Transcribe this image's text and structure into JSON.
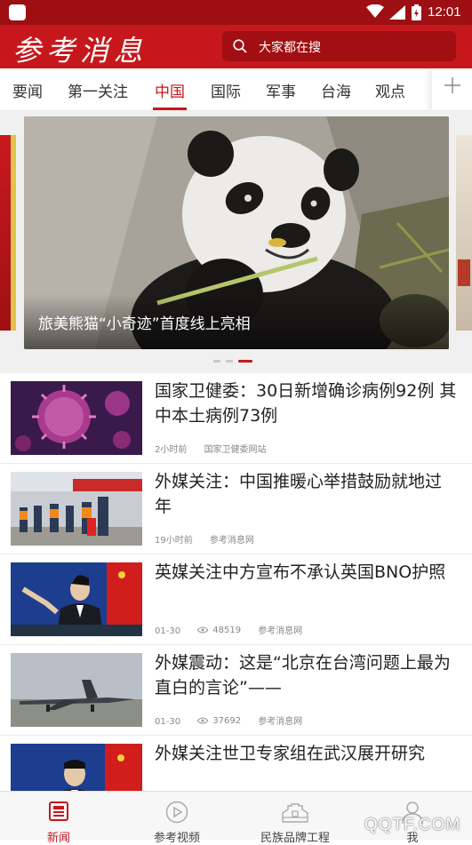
{
  "status_bar": {
    "time": "12:01"
  },
  "header": {
    "logo_text": "参考消息",
    "search_placeholder": "大家都在搜"
  },
  "tabs": [
    {
      "label": "要闻"
    },
    {
      "label": "第一关注"
    },
    {
      "label": "中国",
      "active": true
    },
    {
      "label": "国际"
    },
    {
      "label": "军事"
    },
    {
      "label": "台海"
    },
    {
      "label": "观点"
    }
  ],
  "carousel": {
    "caption": "旅美熊猫“小奇迹”首度线上亮相",
    "dots": 3,
    "active_dot": 2
  },
  "news": [
    {
      "title": "国家卫健委：30日新增确诊病例92例 其中本土病例73例",
      "time": "2小时前",
      "source": "国家卫健委网站"
    },
    {
      "title": "外媒关注：中国推暖心举措鼓励就地过年",
      "time": "19小时前",
      "source": "参考消息网"
    },
    {
      "title": "英媒关注中方宣布不承认英国BNO护照",
      "time": "01-30",
      "views": "48519",
      "source": "参考消息网"
    },
    {
      "title": "外媒震动：这是“北京在台湾问题上最为直白的言论”——",
      "time": "01-30",
      "views": "37692",
      "source": "参考消息网"
    },
    {
      "title": "外媒关注世卫专家组在武汉展开研究",
      "time": "",
      "source": ""
    }
  ],
  "bottom_nav": [
    {
      "label": "新闻",
      "icon": "newspaper-icon",
      "active": true
    },
    {
      "label": "参考视频",
      "icon": "play-circle-icon"
    },
    {
      "label": "民族品牌工程",
      "icon": "great-wall-icon"
    },
    {
      "label": "我",
      "icon": "person-icon"
    }
  ],
  "watermark": "QQTF.COM",
  "colors": {
    "brand_red": "#c6181c",
    "status_bar": "#9d0f12"
  }
}
